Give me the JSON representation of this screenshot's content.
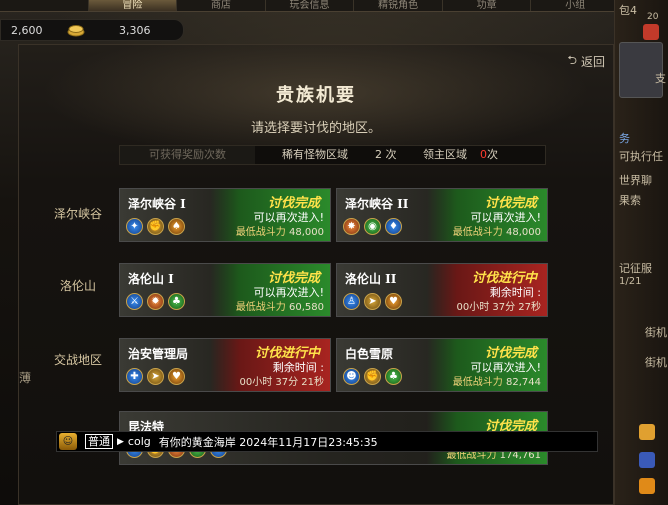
{
  "nav": {
    "tabs": [
      "",
      "冒险",
      "商店",
      "玩会信息",
      "精锐角色",
      "功章",
      "小组"
    ],
    "active_index": 1
  },
  "currency": {
    "gold": "2,600",
    "cash": "3,306"
  },
  "panel": {
    "back_label": "返回",
    "title": "贵族机要",
    "subtitle": "请选择要讨伐的地区。",
    "stats": {
      "reward_label": "可获得奖励次数",
      "rare_label": "稀有怪物区域",
      "rare_count": "2 次",
      "lord_label": "领主区域",
      "lord_count_value": "0",
      "lord_count_unit": "次"
    },
    "regions": [
      {
        "label": "泽尔峡谷"
      },
      {
        "label": "洛伦山"
      },
      {
        "label": "交战地区"
      }
    ],
    "side_char": "薄",
    "cards": [
      {
        "name": "泽尔峡谷 I",
        "status": "讨伐完成",
        "line2": "可以再次进入!",
        "line3_label": "最低战斗力",
        "line3_value": "48,000"
      },
      {
        "name": "泽尔峡谷 II",
        "status": "讨伐完成",
        "line2": "可以再次进入!",
        "line3_label": "最低战斗力",
        "line3_value": "48,000"
      },
      {
        "name": "洛伦山 I",
        "status": "讨伐完成",
        "line2": "可以再次进入!",
        "line3_label": "最低战斗力",
        "line3_value": "60,580"
      },
      {
        "name": "洛伦山 II",
        "status": "讨伐进行中",
        "line2": "剩余时间 :",
        "line3_label": "",
        "line3_value": "00小时 37分 27秒"
      },
      {
        "name": "治安管理局",
        "status": "讨伐进行中",
        "line2": "剩余时间 :",
        "line3_label": "",
        "line3_value": "00小时 37分 21秒"
      },
      {
        "name": "白色雪原",
        "status": "讨伐完成",
        "line2": "可以再次进入!",
        "line3_label": "最低战斗力",
        "line3_value": "82,744"
      },
      {
        "name": "昆法特",
        "status": "讨伐完成",
        "line2": "",
        "line3_label": "最低战斗力",
        "line3_value": "174,761"
      }
    ]
  },
  "chat": {
    "channel": "普通",
    "user": "colg",
    "message": "有你的黄金海岸 2024年11月17日23:45:35"
  },
  "right_strip": {
    "texts": [
      "包4",
      "20",
      "支",
      "务",
      "可执行任",
      "世界聊",
      "果索",
      "记征服",
      "1/21",
      "街机",
      "街机"
    ]
  }
}
